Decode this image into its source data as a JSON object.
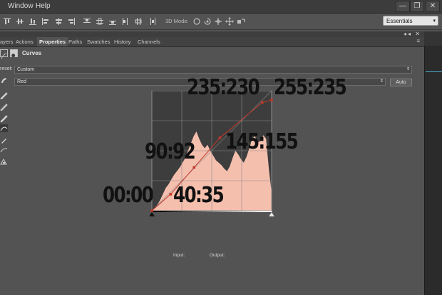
{
  "menu": {
    "items": [
      "Window",
      "Help"
    ]
  },
  "window_controls": {
    "minimize": "—",
    "restore": "❐",
    "close": "✕"
  },
  "options_bar": {
    "mode_3d_label": "3D Mode:",
    "workspace": "Essentials"
  },
  "panel": {
    "tabs": [
      "ayers",
      "Actions",
      "Properties",
      "Paths",
      "Swatches",
      "History",
      "Channels"
    ],
    "active_tab": "Properties",
    "collapse": "◂◂ ✕",
    "menu_icon": "≡"
  },
  "curves": {
    "title": "Curves",
    "preset_label": "reset:",
    "preset_value": "Custom",
    "channel_value": "Red",
    "auto_label": "Auto",
    "input_label": "Input:",
    "output_label": "Output:"
  },
  "chart_data": {
    "type": "line",
    "title": "",
    "xlim": [
      0,
      255
    ],
    "ylim": [
      0,
      255
    ],
    "series": [
      {
        "values": [
          [
            0,
            0
          ],
          [
            40,
            35
          ],
          [
            90,
            92
          ],
          [
            145,
            155
          ],
          [
            235,
            230
          ],
          [
            255,
            235
          ]
        ]
      }
    ],
    "histogram_color": "#f5bfae",
    "curve_color": "#c0392b"
  },
  "annotations": {
    "p1": "00:00",
    "p2": "40:35",
    "p3": "90:92",
    "p4": "145:155",
    "p5": "235:230",
    "p6": "255:235"
  }
}
